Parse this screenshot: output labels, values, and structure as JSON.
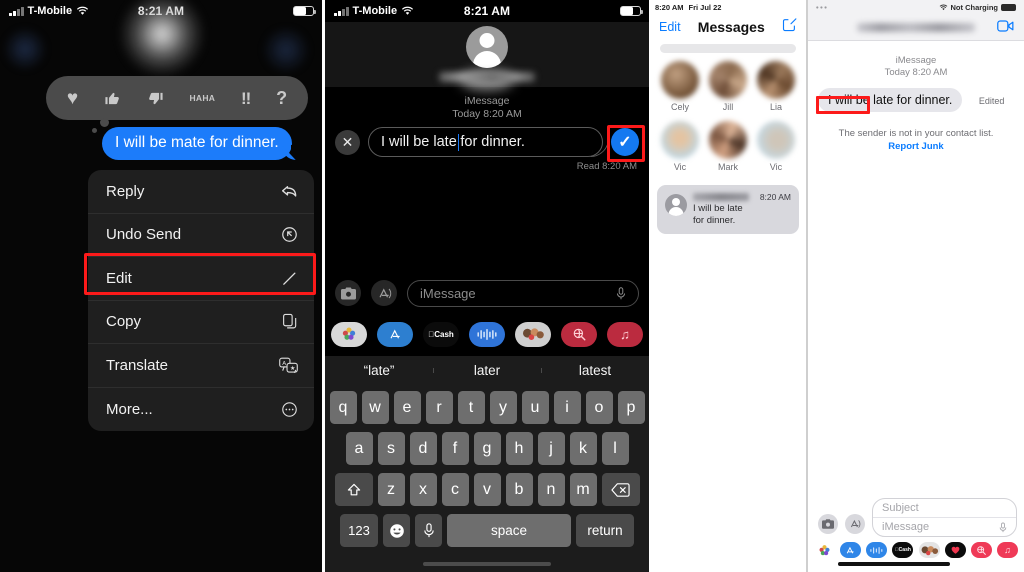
{
  "panel1": {
    "name": "message-context-menu-screen",
    "status_bar": {
      "carrier": "T-Mobile",
      "time": "8:21 AM",
      "wifi_icon": "wifi-icon",
      "battery_icon": "battery-icon",
      "signal_icon": "cellular-bars-icon"
    },
    "tapbacks": [
      {
        "name": "heart",
        "glyph": "♥"
      },
      {
        "name": "thumbs-up",
        "glyph": "👍"
      },
      {
        "name": "thumbs-down",
        "glyph": "👎"
      },
      {
        "name": "haha",
        "line1": "HA",
        "line2": "HA"
      },
      {
        "name": "exclamation",
        "glyph": "!!"
      },
      {
        "name": "question",
        "glyph": "?"
      }
    ],
    "sent_bubble_text": "I will be mate for dinner.",
    "menu_items": [
      {
        "label": "Reply",
        "icon": "reply-arrow-icon"
      },
      {
        "label": "Undo Send",
        "icon": "undo-circle-icon"
      },
      {
        "label": "Edit",
        "icon": "pencil-icon"
      },
      {
        "label": "Copy",
        "icon": "copy-pages-icon"
      },
      {
        "label": "Translate",
        "icon": "translate-icon"
      },
      {
        "label": "More...",
        "icon": "ellipsis-circle-icon"
      }
    ],
    "highlight_color": "#fc1a1a",
    "highlighted_item": "Edit"
  },
  "panel2": {
    "name": "edit-message-screen",
    "status_bar": {
      "carrier": "T-Mobile",
      "time": "8:21 AM"
    },
    "contact_name_redacted": true,
    "service_label": "iMessage",
    "date_label": "Today 8:20 AM",
    "edit_field": {
      "text_before_caret": "I will be late",
      "text_after_caret": " for dinner.",
      "full_value": "I will be late for dinner."
    },
    "cancel_icon": "close-x-icon",
    "confirm_icon": "checkmark-icon",
    "confirm_color": "#1479f0",
    "read_receipt": "Read 8:20 AM",
    "input_placeholder": "iMessage",
    "camera_icon": "camera-icon",
    "appstore_icon": "app-store-icon",
    "mic_icon": "microphone-icon",
    "app_drawer": [
      {
        "name": "photos-app-icon",
        "label": "",
        "color": "#d8d8d8"
      },
      {
        "name": "app-store-icon",
        "label": "",
        "color": "#2d7fd0"
      },
      {
        "name": "apple-cash-icon",
        "label": "Cash",
        "color": "#0b0b0b"
      },
      {
        "name": "audio-message-icon",
        "label": "",
        "color": "#2f74d8"
      },
      {
        "name": "memoji-stickers-icon",
        "label": "",
        "color": "#cfcfcf"
      },
      {
        "name": "image-search-icon",
        "label": "",
        "color": "#bb2b3f"
      },
      {
        "name": "music-icon",
        "label": "♫",
        "color": "#bb2b3f"
      }
    ],
    "predictions": [
      "“late”",
      "later",
      "latest"
    ],
    "keyboard": {
      "row1": [
        "q",
        "w",
        "e",
        "r",
        "t",
        "y",
        "u",
        "i",
        "o",
        "p"
      ],
      "row2": [
        "a",
        "s",
        "d",
        "f",
        "g",
        "h",
        "j",
        "k",
        "l"
      ],
      "row3": [
        "z",
        "x",
        "c",
        "v",
        "b",
        "n",
        "m"
      ],
      "shift_icon": "shift-arrow-icon",
      "backspace_icon": "backspace-icon",
      "numbers_key": "123",
      "emoji_icon": "emoji-smiley-icon",
      "dictation_icon": "microphone-icon",
      "space_key": "space",
      "return_key": "return"
    },
    "highlight_color": "#fc1a1a",
    "highlighted_item": "confirm-checkmark"
  },
  "panel3": {
    "name": "messages-list-screen",
    "status_bar": {
      "time": "8:20 AM",
      "date": "Fri Jul 22"
    },
    "edit_label": "Edit",
    "title": "Messages",
    "compose_icon": "compose-pencil-square-icon",
    "search_placeholder": "",
    "pinned": [
      {
        "name": "Cely"
      },
      {
        "name": "Jill"
      },
      {
        "name": "Lia"
      },
      {
        "name": "Vic"
      },
      {
        "name": "Mark"
      },
      {
        "name": "Vic"
      }
    ],
    "conversation": {
      "sender_redacted": true,
      "time": "8:20 AM",
      "preview_line1": "I will be late",
      "preview_line2": "for dinner.",
      "avatar_icon": "person-avatar-icon"
    }
  },
  "panel4": {
    "name": "received-edited-message-screen",
    "status_bar": {
      "left_icon": "ellipsis-icon",
      "wifi_icon": "wifi-icon",
      "charging_text": "Not Charging",
      "battery_icon": "battery-icon"
    },
    "contact_name_redacted": true,
    "facetime_icon": "facetime-video-icon",
    "service_label": "iMessage",
    "date_label": "Today 8:20 AM",
    "received_bubble_text": "I will be late for dinner.",
    "edited_label": "Edited",
    "notice_text": "The sender is not in your contact list.",
    "report_junk_label": "Report Junk",
    "subject_placeholder": "Subject",
    "imessage_placeholder": "iMessage",
    "camera_icon": "camera-icon",
    "appstore_icon": "app-store-icon",
    "mic_icon": "microphone-icon",
    "app_drawer": [
      {
        "name": "photos-app-icon",
        "label": "",
        "color": "#ffffff"
      },
      {
        "name": "app-store-icon",
        "label": "",
        "color": "#2f86e8"
      },
      {
        "name": "music-wave-icon",
        "label": "",
        "color": "#2f86e8"
      },
      {
        "name": "apple-cash-icon",
        "label": "Cash",
        "color": "#0b0b0b"
      },
      {
        "name": "memoji-stickers-icon",
        "label": "",
        "color": "#e4e4e4"
      },
      {
        "name": "digital-touch-icon",
        "label": "",
        "color": "#0b0b0b"
      },
      {
        "name": "image-search-icon",
        "label": "",
        "color": "#ef3a57"
      },
      {
        "name": "music-icon",
        "label": "♫",
        "color": "#ef3a57"
      }
    ],
    "highlight_color": "#fc1a1a",
    "highlighted_item": "Edited"
  }
}
